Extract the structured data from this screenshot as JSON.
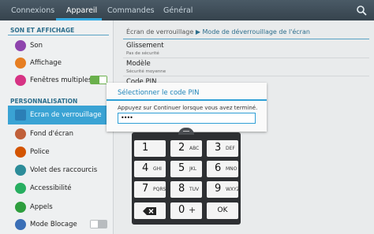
{
  "tabs": [
    "Connexions",
    "Appareil",
    "Commandes",
    "Général"
  ],
  "active_tab": "Appareil",
  "sidebar": {
    "sections": [
      {
        "header": "SON ET AFFICHAGE",
        "items": [
          {
            "label": "Son",
            "icon": "speaker-icon",
            "color": "#8e44ad"
          },
          {
            "label": "Affichage",
            "icon": "display-icon",
            "color": "#e67e22"
          },
          {
            "label": "Fenêtres multiples",
            "icon": "multi-window-icon",
            "color": "#d63384",
            "toggle": true
          }
        ]
      },
      {
        "header": "PERSONNALISATION",
        "items": [
          {
            "label": "Ecran de verrouillage",
            "icon": "lock-screen-icon",
            "color": "#2b7fb6",
            "selected": true
          },
          {
            "label": "Fond d'écran",
            "icon": "wallpaper-icon",
            "color": "#c0603a"
          },
          {
            "label": "Police",
            "icon": "font-icon",
            "color": "#d35400"
          },
          {
            "label": "Volet des raccourcis",
            "icon": "shortcuts-icon",
            "color": "#2c8c99"
          },
          {
            "label": "Accessibilité",
            "icon": "accessibility-icon",
            "color": "#27ae60"
          },
          {
            "label": "Appels",
            "icon": "phone-icon",
            "color": "#2e9e3e"
          },
          {
            "label": "Mode Blocage",
            "icon": "block-mode-icon",
            "color": "#3b6fb6",
            "toggle": false
          }
        ]
      }
    ]
  },
  "breadcrumb": {
    "parent": "Écran de verrouillage",
    "current": "Mode de déverrouillage de l'écran"
  },
  "options": [
    {
      "title": "Glissement",
      "subtitle": "Pas de sécurité"
    },
    {
      "title": "Modèle",
      "subtitle": "Sécurité moyenne"
    },
    {
      "title": "Code PIN",
      "subtitle": ""
    }
  ],
  "dialog": {
    "title": "Sélectionner le code PIN",
    "message": "Appuyez sur Continuer lorsque vous avez terminé.",
    "value": "••••"
  },
  "keypad": {
    "keys": [
      {
        "num": "1",
        "letters": ""
      },
      {
        "num": "2",
        "letters": "ABC"
      },
      {
        "num": "3",
        "letters": "DEF"
      },
      {
        "num": "4",
        "letters": "GHI"
      },
      {
        "num": "5",
        "letters": "JKL"
      },
      {
        "num": "6",
        "letters": "MNO"
      },
      {
        "num": "7",
        "letters": "PQRS"
      },
      {
        "num": "8",
        "letters": "TUV"
      },
      {
        "num": "9",
        "letters": "WXYZ"
      },
      {
        "num": "",
        "letters": "",
        "special": "backspace"
      },
      {
        "num": "0",
        "letters": "+"
      },
      {
        "num": "OK",
        "letters": "",
        "special": "ok"
      }
    ]
  },
  "colors": {
    "accent": "#2f9fd6",
    "topbar": "#3d4b55",
    "selected": "#3aa3d4"
  }
}
